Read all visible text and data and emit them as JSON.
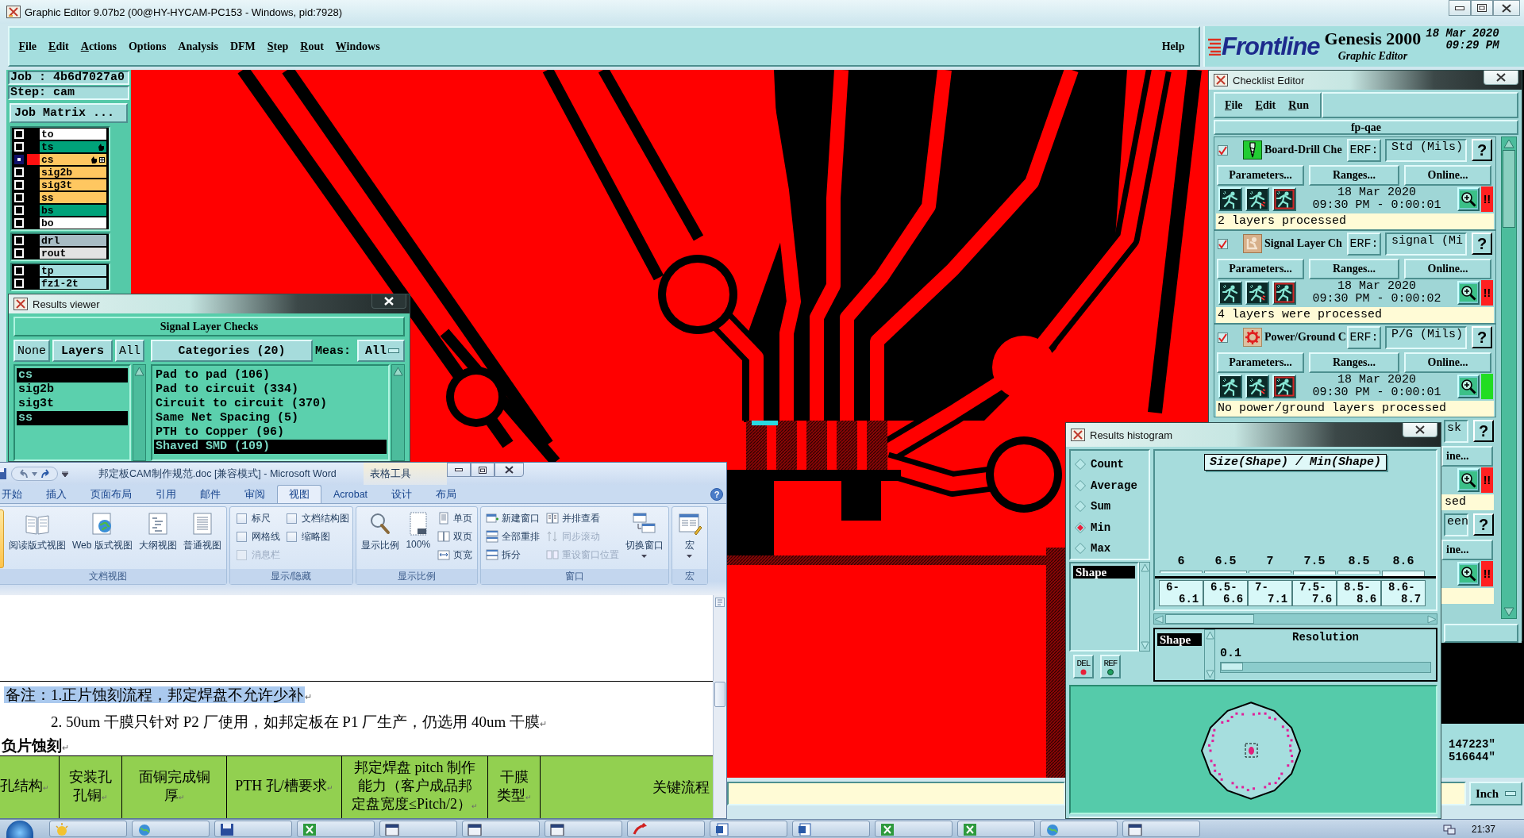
{
  "window": {
    "title": "Graphic Editor 9.07b2 (00@HY-HYCAM-PC153 - Windows, pid:7928)"
  },
  "menu": {
    "items": [
      {
        "label": "File",
        "mnemonic": true
      },
      {
        "label": "Edit",
        "mnemonic": true
      },
      {
        "label": "Actions",
        "mnemonic": true
      },
      {
        "label": "Options",
        "mnemonic": false
      },
      {
        "label": "Analysis",
        "mnemonic": false
      },
      {
        "label": "DFM",
        "mnemonic": false
      },
      {
        "label": "Step",
        "mnemonic": true
      },
      {
        "label": "Rout",
        "mnemonic": true
      },
      {
        "label": "Windows",
        "mnemonic": true
      }
    ],
    "help": "Help"
  },
  "brand": {
    "logo": "Frontline",
    "product": "Genesis 2000",
    "subtitle": "Graphic Editor",
    "date": "18 Mar 2020",
    "time": "09:29 PM"
  },
  "job_panel": {
    "job": "Job : 4b6d7027a0",
    "step": "Step: cam",
    "matrix_button": "Job Matrix ..."
  },
  "layer_groups": [
    {
      "layers": [
        {
          "name": "to",
          "color": "#ffffff",
          "work_layer": false,
          "hand_mark": false,
          "grid_mark": false
        },
        {
          "name": "ts",
          "color": "#00a27a",
          "work_layer": false,
          "hand_mark": true,
          "grid_mark": false
        },
        {
          "name": "cs",
          "color": "#ffc760",
          "work_layer": true,
          "hand_mark": true,
          "grid_mark": true
        },
        {
          "name": "sig2b",
          "color": "#ffc760",
          "work_layer": false,
          "hand_mark": false,
          "grid_mark": false
        },
        {
          "name": "sig3t",
          "color": "#ffc760",
          "work_layer": false,
          "hand_mark": false,
          "grid_mark": false
        },
        {
          "name": "ss",
          "color": "#ffc760",
          "work_layer": false,
          "hand_mark": false,
          "grid_mark": false
        },
        {
          "name": "bs",
          "color": "#00a27a",
          "work_layer": false,
          "hand_mark": false,
          "grid_mark": false
        },
        {
          "name": "bo",
          "color": "#ffffff",
          "work_layer": false,
          "hand_mark": false,
          "grid_mark": false
        }
      ]
    },
    {
      "layers": [
        {
          "name": "drl",
          "color": "#a8bcc4",
          "work_layer": false,
          "hand_mark": false,
          "grid_mark": false
        },
        {
          "name": "rout",
          "color": "#e2e2e2",
          "work_layer": false,
          "hand_mark": false,
          "grid_mark": false
        }
      ]
    },
    {
      "layers": [
        {
          "name": "tp",
          "color": "#a6dede",
          "work_layer": false,
          "hand_mark": false,
          "grid_mark": false
        },
        {
          "name": "fz1-2t",
          "color": "#a6dede",
          "work_layer": false,
          "hand_mark": false,
          "grid_mark": false
        }
      ]
    }
  ],
  "results_viewer": {
    "title": "Results viewer",
    "heading": "Signal Layer Checks",
    "none_button": "None",
    "layers_button": "Layers",
    "all_button": "All",
    "categories_button": "Categories (20)",
    "meas_label": "Meas:",
    "meas_value": "All",
    "layers": [
      {
        "name": "cs",
        "selected": true
      },
      {
        "name": "sig2b",
        "selected": false
      },
      {
        "name": "sig3t",
        "selected": false
      },
      {
        "name": "ss",
        "selected": true
      }
    ],
    "categories": [
      {
        "label": "Pad to pad (106)",
        "selected": false
      },
      {
        "label": "Pad to circuit (334)",
        "selected": false
      },
      {
        "label": "Circuit to circuit (370)",
        "selected": false
      },
      {
        "label": "Same Net Spacing (5)",
        "selected": false
      },
      {
        "label": "PTH to Copper (96)",
        "selected": false
      },
      {
        "label": "Shaved SMD (109)",
        "selected": true
      }
    ]
  },
  "checklist": {
    "title": "Checklist Editor",
    "menu": [
      "File",
      "Edit",
      "Run"
    ],
    "name": "fp-qae",
    "checks": [
      {
        "kind": "full",
        "checked": true,
        "name": "Board-Drill Che",
        "erf_label": "ERF:",
        "erf_value": "Std (Mils)",
        "help": "?",
        "buttons": [
          "Parameters...",
          "Ranges...",
          "Online..."
        ],
        "date": "18 Mar 2020",
        "run_time": "09:30 PM - 0:00:01",
        "color": "#ff2020",
        "alert": "!!",
        "message": "2 layers processed"
      },
      {
        "kind": "full",
        "checked": true,
        "name": "Signal Layer Ch",
        "erf_label": "ERF:",
        "erf_value": "signal (Mi",
        "help": "?",
        "buttons": [
          "Parameters...",
          "Ranges...",
          "Online..."
        ],
        "date": "18 Mar 2020",
        "run_time": "09:30 PM - 0:00:02",
        "color": "#ff2020",
        "alert": "!!",
        "message": "4 layers were processed"
      },
      {
        "kind": "full",
        "checked": true,
        "name": "Power/Ground C",
        "erf_label": "ERF:",
        "erf_value": "P/G (Mils)",
        "help": "?",
        "buttons": [
          "Parameters...",
          "Ranges...",
          "Online..."
        ],
        "date": "18 Mar 2020",
        "run_time": "09:30 PM - 0:00:01",
        "color": "#22dd22",
        "message": "No power/ground layers processed"
      },
      {
        "kind": "partial",
        "erf_value": "sk",
        "help": "?",
        "online": "ine...",
        "color": "#ff2020",
        "alert": "!!",
        "message": "sed"
      },
      {
        "kind": "partial",
        "erf_value": "een",
        "help": "?",
        "online": "ine...",
        "color": "#ff2020",
        "alert": "!!"
      }
    ]
  },
  "histogram": {
    "title": "Results histogram",
    "modes": [
      {
        "label": "Count",
        "selected": false
      },
      {
        "label": "Average",
        "selected": false
      },
      {
        "label": "Sum",
        "selected": false
      },
      {
        "label": "Min",
        "selected": true
      },
      {
        "label": "Max",
        "selected": false
      }
    ],
    "fields": [
      {
        "label": "Shape",
        "selected": true
      }
    ],
    "del_button": "DEL",
    "ref_button": "REF",
    "chart_title": "Size(Shape) / Min(Shape)",
    "bins": [
      {
        "value": "6",
        "range": "6- 6.1"
      },
      {
        "value": "6.5",
        "range": "6.5- 6.6"
      },
      {
        "value": "7",
        "range": "7- 7.1"
      },
      {
        "value": "7.5",
        "range": "7.5- 7.6"
      },
      {
        "value": "8.5",
        "range": "8.5- 8.6"
      },
      {
        "value": "8.6",
        "range": "8.6- 8.7"
      }
    ],
    "selection": [
      {
        "label": "Shape",
        "selected": true
      }
    ],
    "resolution_label": "Resolution",
    "resolution_value": "0.1",
    "resolution_slider": {
      "level": 0
    }
  },
  "readout": {
    "coordinates": [
      "147223\"",
      "516644\""
    ],
    "units": "Inch"
  },
  "word": {
    "title": "邦定板CAM制作规范.doc [兼容模式] - Microsoft Word",
    "context_tools": "表格工具",
    "help": "?",
    "tabs": [
      {
        "label": "开始",
        "selected": false
      },
      {
        "label": "插入",
        "selected": false
      },
      {
        "label": "页面布局",
        "selected": false
      },
      {
        "label": "引用",
        "selected": false
      },
      {
        "label": "邮件",
        "selected": false
      },
      {
        "label": "审阅",
        "selected": false
      },
      {
        "label": "视图",
        "selected": true
      },
      {
        "label": "Acrobat",
        "selected": false
      },
      {
        "label": "设计",
        "selected": false
      },
      {
        "label": "布局",
        "selected": false
      }
    ],
    "ribbon": [
      {
        "label": "文档视图",
        "columns": [
          {
            "kind": "edge",
            "selected": true
          },
          {
            "kind": "large",
            "items": [
              {
                "label": "阅读版式视图",
                "dropdown": false
              }
            ]
          },
          {
            "kind": "large",
            "items": [
              {
                "label": "Web 版式视图",
                "dropdown": false
              }
            ]
          },
          {
            "kind": "large",
            "items": [
              {
                "label": "大纲视图",
                "dropdown": false
              }
            ]
          },
          {
            "kind": "large",
            "items": [
              {
                "label": "普通视图",
                "dropdown": false
              }
            ]
          }
        ]
      },
      {
        "label": "显示/隐藏",
        "columns": [
          {
            "kind": "checks",
            "items": [
              {
                "label": "标尺",
                "checked": false,
                "disabled": false
              },
              {
                "label": "网格线",
                "checked": false,
                "disabled": false
              },
              {
                "label": "消息栏",
                "checked": false,
                "disabled": true
              }
            ]
          },
          {
            "kind": "checks",
            "items": [
              {
                "label": "文档结构图",
                "checked": false,
                "disabled": false
              },
              {
                "label": "缩略图",
                "checked": false,
                "disabled": false
              }
            ]
          }
        ]
      },
      {
        "label": "显示比例",
        "columns": [
          {
            "kind": "large",
            "items": [
              {
                "label": "显示比例",
                "dropdown": false
              }
            ]
          },
          {
            "kind": "large",
            "items": [
              {
                "label": "100%",
                "dropdown": false
              }
            ]
          },
          {
            "kind": "small",
            "items": [
              {
                "label": "单页",
                "disabled": false
              },
              {
                "label": "双页",
                "disabled": false
              },
              {
                "label": "页宽",
                "disabled": false
              }
            ]
          }
        ]
      },
      {
        "label": "窗口",
        "columns": [
          {
            "kind": "small",
            "items": [
              {
                "label": "新建窗口",
                "disabled": false
              },
              {
                "label": "全部重排",
                "disabled": false
              },
              {
                "label": "拆分",
                "disabled": false
              }
            ]
          },
          {
            "kind": "small",
            "items": [
              {
                "label": "并排查看",
                "disabled": false
              },
              {
                "label": "同步滚动",
                "disabled": true
              },
              {
                "label": "重设窗口位置",
                "disabled": true
              }
            ]
          },
          {
            "kind": "large",
            "items": [
              {
                "label": "切换窗口",
                "dropdown": true
              }
            ]
          }
        ]
      },
      {
        "label": "宏",
        "columns": [
          {
            "kind": "large",
            "items": [
              {
                "label": "宏",
                "dropdown": true
              }
            ]
          }
        ]
      }
    ]
  },
  "document": {
    "paragraphs": [
      {
        "kind": "note",
        "text": "备注：1.正片蚀刻流程，邦定焊盘不允许少补",
        "mark": "↵",
        "selected": true
      },
      {
        "kind": "continued",
        "text": "2. 50um 干膜只针对 P2 厂使用，如邦定板在 P1 厂生产，仍选用 40um 干膜",
        "mark": "↵",
        "selected": false
      },
      {
        "kind": "heading",
        "text": "负片蚀刻",
        "mark": "↵",
        "selected": false
      }
    ],
    "table": {
      "header": [
        {
          "text": "孔结构",
          "mark": "↵"
        },
        {
          "text": "安装孔孔铜",
          "mark": "↵"
        },
        {
          "text": "面铜完成铜厚",
          "mark": "↵"
        },
        {
          "text": "PTH 孔/槽要求",
          "mark": "↵"
        },
        {
          "text": "邦定焊盘 pitch 制作能力（客户成品邦定盘宽度≤Pitch/2）",
          "mark": "↵"
        },
        {
          "text": "干膜类型",
          "mark": "↵"
        },
        {
          "text": "关键流程"
        }
      ]
    }
  },
  "taskbar": {
    "clock": "21:37"
  }
}
